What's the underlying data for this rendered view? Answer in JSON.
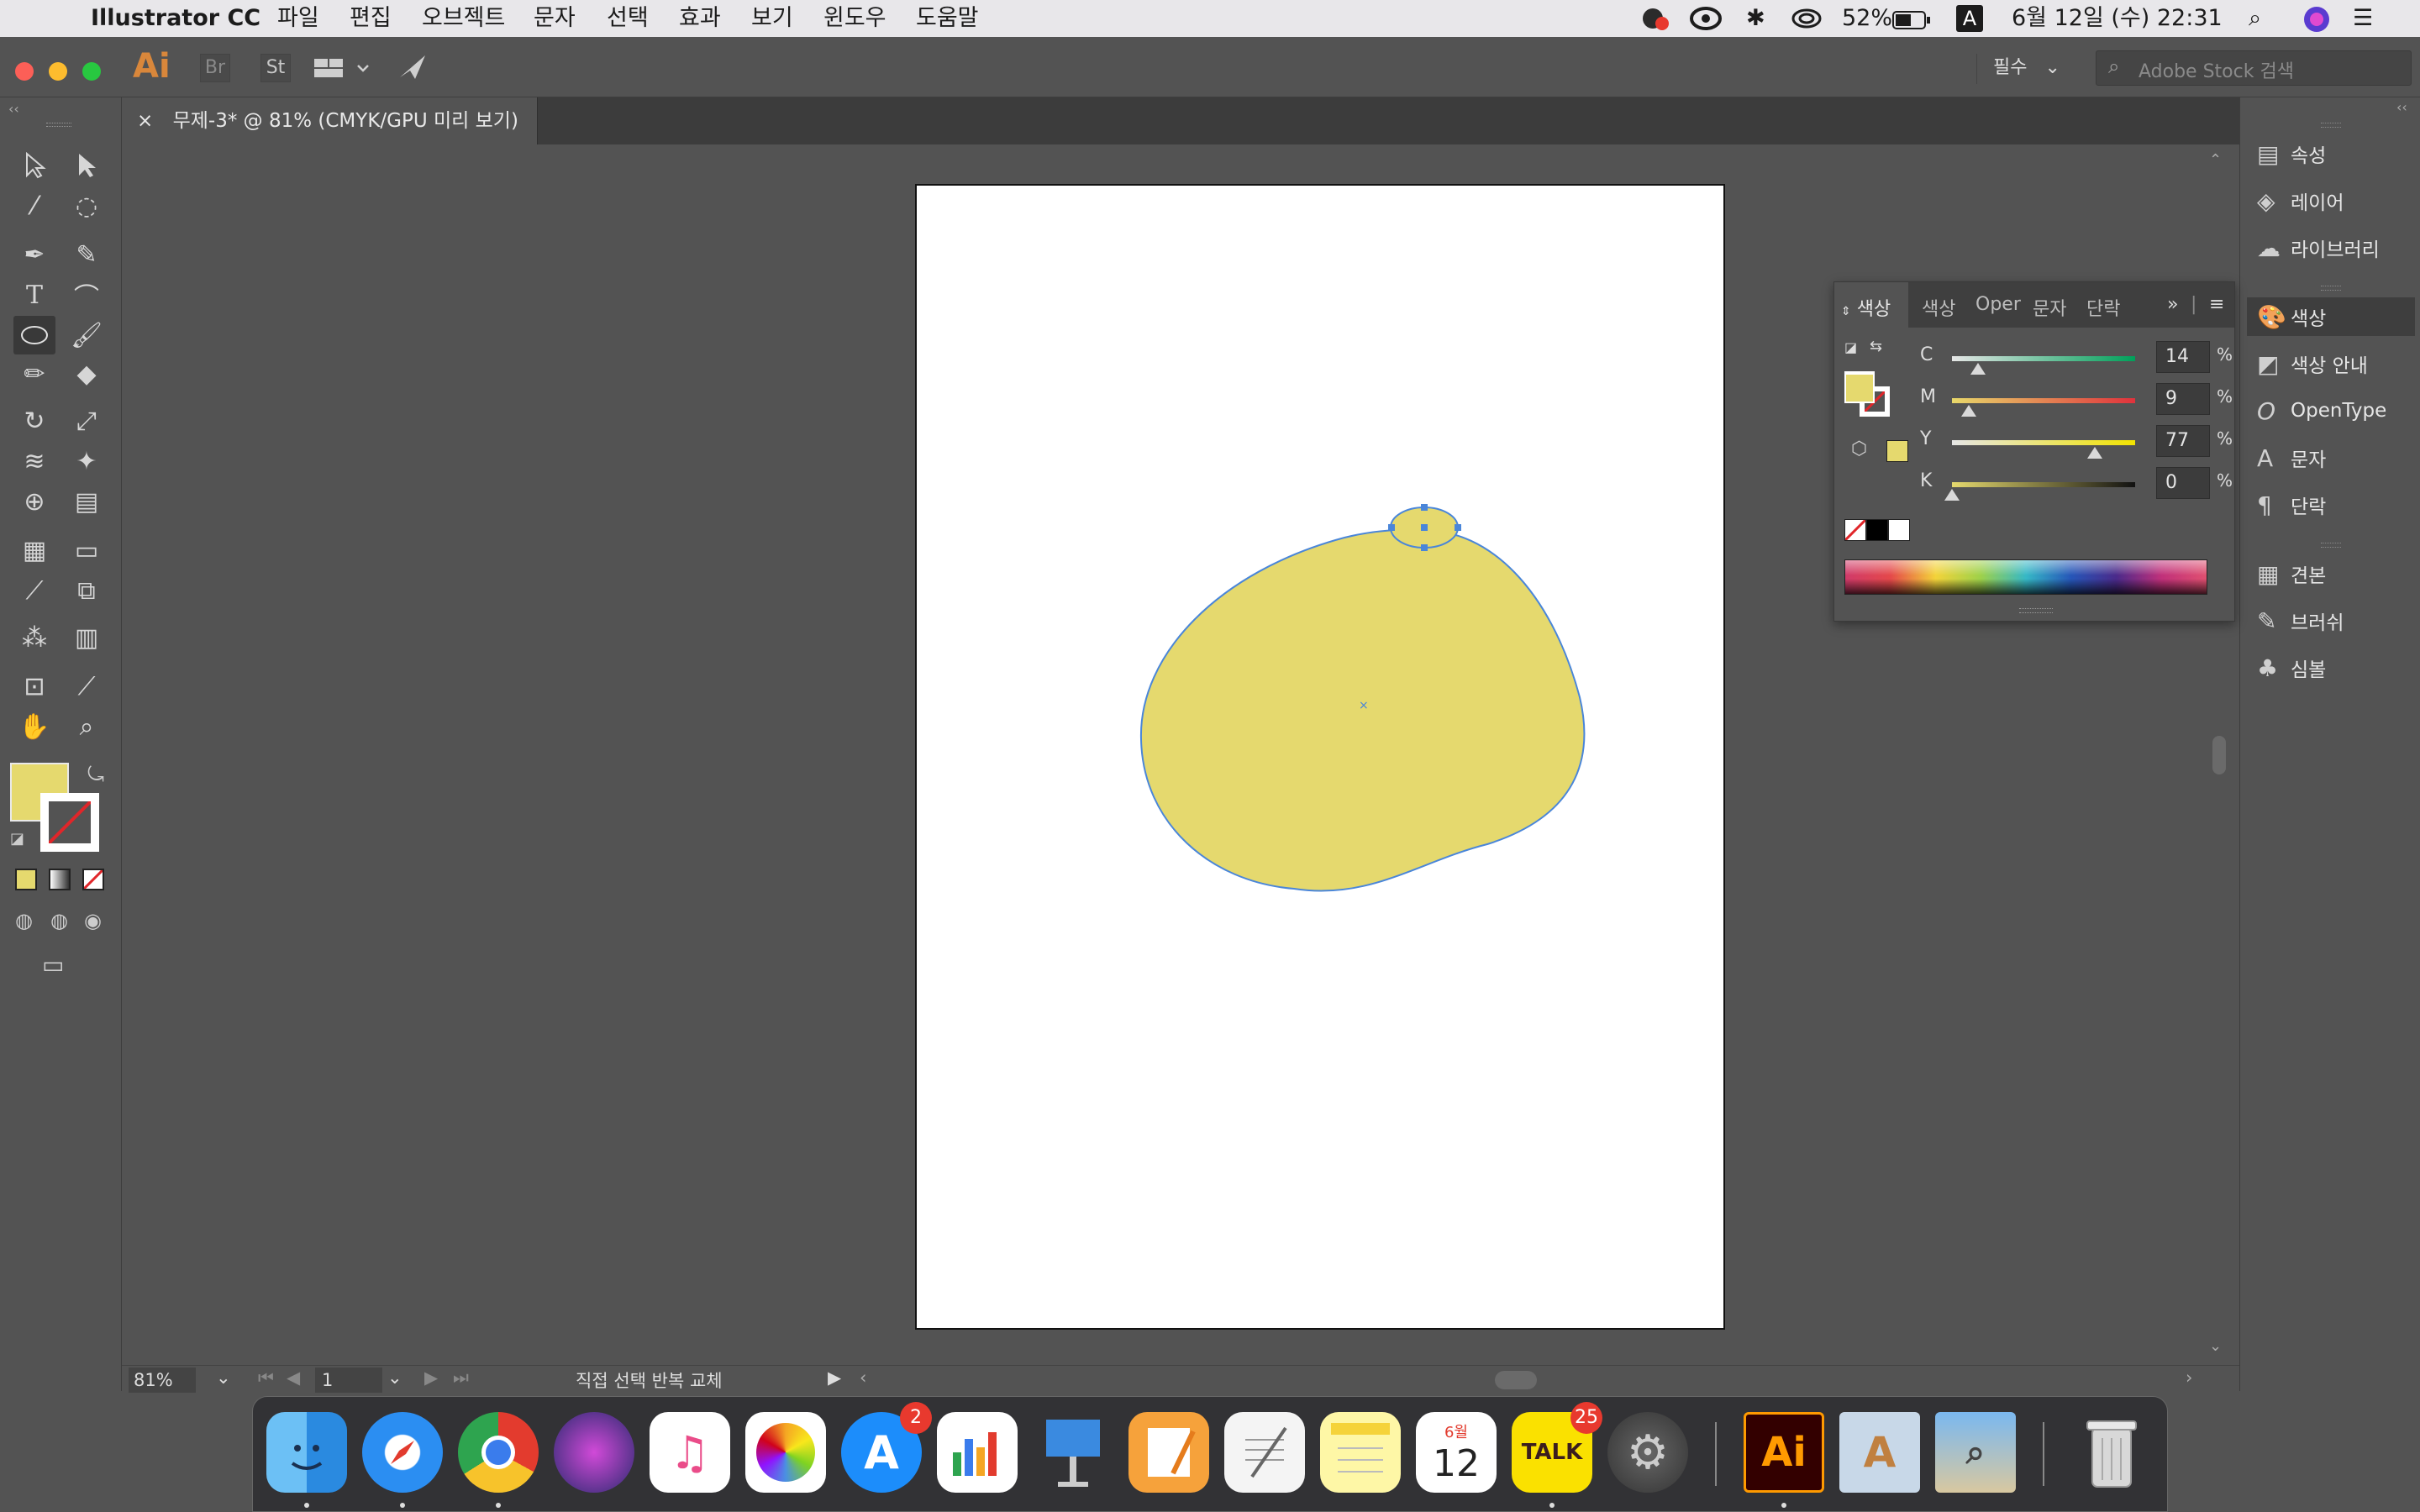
{
  "menubar": {
    "apple_icon": "apple-icon",
    "app_name": "Illustrator CC",
    "menus": [
      "파일",
      "편집",
      "오브젝트",
      "문자",
      "선택",
      "효과",
      "보기",
      "윈도우",
      "도움말"
    ],
    "battery": "52%",
    "input_indicator": "A",
    "datetime": "6월 12일 (수)  22:31"
  },
  "appbar": {
    "logo": "Ai",
    "bridge": "Br",
    "stock": "St",
    "workspace": "필수",
    "search_placeholder": "Adobe Stock 검색"
  },
  "tab": {
    "close": "×",
    "title": "무제-3* @ 81% (CMYK/GPU 미리 보기)"
  },
  "toolbar": {
    "tools": [
      "select",
      "direct-select",
      "magic-wand",
      "lasso",
      "pen",
      "curvature",
      "type",
      "arc",
      "ellipse",
      "paintbrush",
      "pencil",
      "eraser",
      "rotate",
      "scale",
      "warp",
      "puppet-warp",
      "shape-builder",
      "perspective-grid",
      "mesh",
      "gradient",
      "eyedropper",
      "blend",
      "symbol-sprayer",
      "column-graph",
      "artboard",
      "slice",
      "hand",
      "zoom"
    ],
    "selected_tool": "ellipse",
    "fill_color": "#e5d96e"
  },
  "colorpanel": {
    "tabs": [
      "색상",
      "색상",
      "Oper",
      "문자",
      "단락"
    ],
    "channels": [
      {
        "label": "C",
        "value": "14",
        "pos": 0.14,
        "gradient": [
          "#e6e6e6",
          "#00a05a"
        ]
      },
      {
        "label": "M",
        "value": "9",
        "pos": 0.09,
        "gradient": [
          "#e8d86a",
          "#e0323c"
        ]
      },
      {
        "label": "Y",
        "value": "77",
        "pos": 0.77,
        "gradient": [
          "#e6e6e6",
          "#f2e400"
        ]
      },
      {
        "label": "K",
        "value": "0",
        "pos": 0.0,
        "gradient": [
          "#e5d96e",
          "#111111"
        ]
      }
    ],
    "pct": "%"
  },
  "rightpanel": {
    "items": [
      {
        "label": "속성",
        "icon": "properties-icon"
      },
      {
        "label": "레이어",
        "icon": "layers-icon"
      },
      {
        "label": "라이브러리",
        "icon": "libraries-icon"
      },
      {
        "label": "색상",
        "icon": "color-icon"
      },
      {
        "label": "색상 안내",
        "icon": "color-guide-icon"
      },
      {
        "label": "OpenType",
        "icon": "opentype-icon"
      },
      {
        "label": "문자",
        "icon": "character-icon"
      },
      {
        "label": "단락",
        "icon": "paragraph-icon"
      },
      {
        "label": "견본",
        "icon": "swatches-icon"
      },
      {
        "label": "브러쉬",
        "icon": "brushes-icon"
      },
      {
        "label": "심볼",
        "icon": "symbols-icon"
      }
    ]
  },
  "statusbar": {
    "zoom": "81%",
    "page": "1",
    "status": "직접 선택 반복 교체"
  },
  "dock": {
    "calendar_month": "6월",
    "calendar_day": "12",
    "appstore_badge": "2",
    "kakao_label": "TALK",
    "kakao_badge": "25",
    "ai_label": "Ai"
  },
  "shape": {
    "fill": "#e5d96e",
    "stroke": "#4a86d9"
  }
}
